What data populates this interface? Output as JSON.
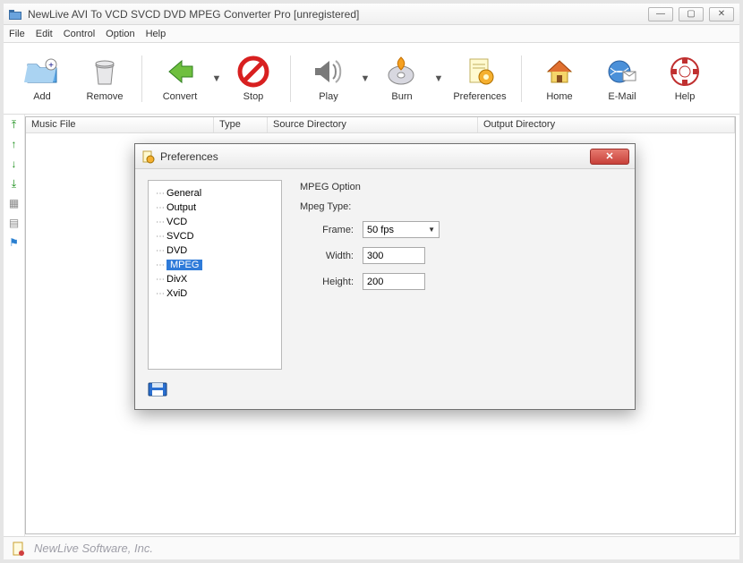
{
  "window": {
    "title": "NewLive AVI To VCD SVCD DVD MPEG Converter Pro  [unregistered]"
  },
  "menubar": [
    "File",
    "Edit",
    "Control",
    "Option",
    "Help"
  ],
  "toolbar": [
    {
      "label": "Add",
      "icon": "add"
    },
    {
      "label": "Remove",
      "icon": "remove"
    },
    {
      "label": "Convert",
      "icon": "convert",
      "dropdown": true,
      "sep_before": true
    },
    {
      "label": "Stop",
      "icon": "stop"
    },
    {
      "label": "Play",
      "icon": "play",
      "dropdown": true,
      "sep_before": true
    },
    {
      "label": "Burn",
      "icon": "burn",
      "dropdown": true
    },
    {
      "label": "Preferences",
      "icon": "prefs"
    },
    {
      "label": "Home",
      "icon": "home",
      "sep_before": true
    },
    {
      "label": "E-Mail",
      "icon": "email"
    },
    {
      "label": "Help",
      "icon": "help"
    }
  ],
  "columns": [
    "Music File",
    "Type",
    "Source Directory",
    "Output Directory"
  ],
  "status": {
    "company": "NewLive Software, Inc."
  },
  "dialog": {
    "title": "Preferences",
    "tree": [
      "General",
      "Output",
      "VCD",
      "SVCD",
      "DVD",
      "MPEG",
      "DivX",
      "XviD"
    ],
    "tree_selected_index": 5,
    "section_title": "MPEG Option",
    "mpeg": {
      "type_label": "Mpeg Type:",
      "frame_label": "Frame:",
      "frame_value": "50 fps",
      "width_label": "Width:",
      "width_value": "300",
      "height_label": "Height:",
      "height_value": "200"
    }
  }
}
